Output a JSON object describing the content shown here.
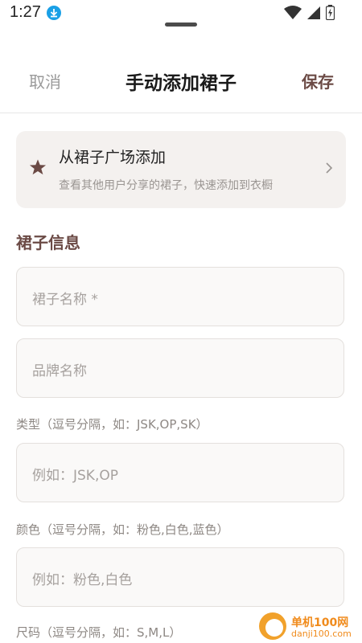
{
  "status_bar": {
    "time": "1:27",
    "icons": [
      "download-icon",
      "wifi-icon",
      "signal-icon",
      "battery-icon"
    ]
  },
  "header": {
    "cancel_label": "取消",
    "title": "手动添加裙子",
    "save_label": "保存"
  },
  "plaza_card": {
    "icon": "star-icon",
    "title": "从裙子广场添加",
    "subtitle": "查看其他用户分享的裙子，快速添加到衣橱",
    "chevron": "›"
  },
  "section": {
    "title": "裙子信息"
  },
  "fields": {
    "name_placeholder": "裙子名称 *",
    "brand_placeholder": "品牌名称",
    "type_label": "类型（逗号分隔，如：JSK,OP,SK）",
    "type_placeholder": "例如：JSK,OP",
    "color_label": "颜色（逗号分隔，如：粉色,白色,蓝色）",
    "color_placeholder": "例如：粉色,白色",
    "size_label": "尺码（逗号分隔，如：S,M,L）"
  },
  "watermark": {
    "name": "单机100网",
    "domain": "danji100.com"
  },
  "colors": {
    "accent": "#6b4a45",
    "card_bg": "#f4f1ef",
    "field_bg": "#faf9f8"
  }
}
